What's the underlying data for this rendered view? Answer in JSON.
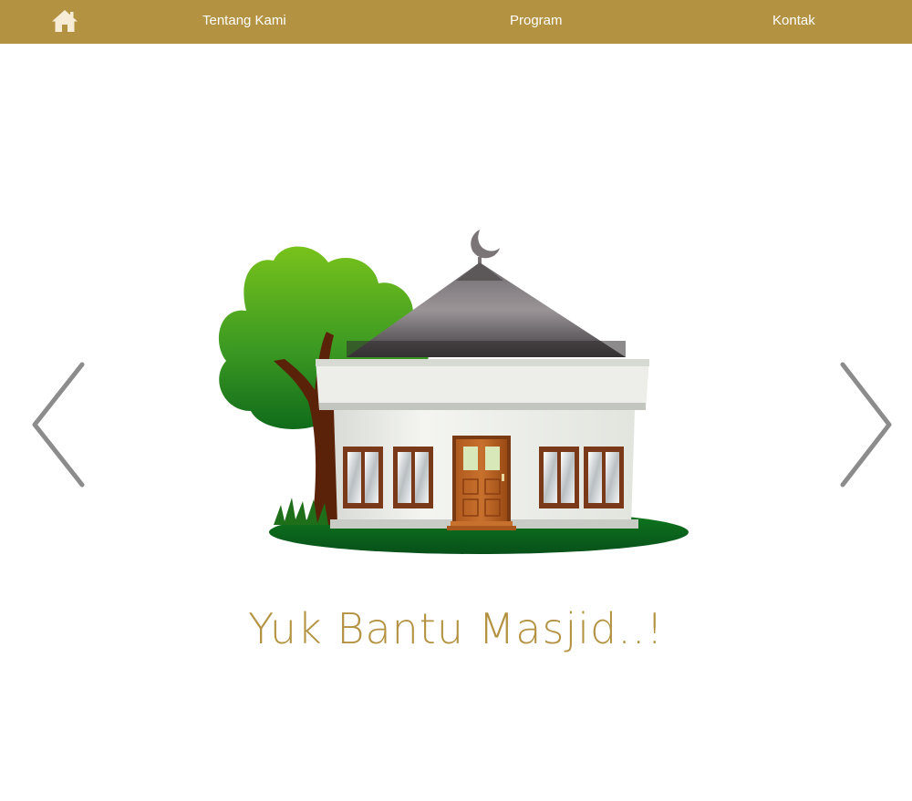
{
  "nav": {
    "home_icon": "home-icon",
    "items": [
      {
        "label": "Tentang Kami"
      },
      {
        "label": "Program"
      },
      {
        "label": "Kontak"
      }
    ],
    "bar_color": "#b39242",
    "home_icon_color": "#f7ecd6"
  },
  "slider": {
    "prev_icon": "chevron-left-icon",
    "next_icon": "chevron-right-icon",
    "image": "mosque-illustration",
    "caption": "Yuk Bantu Masjid..!",
    "caption_color": "#b39242"
  }
}
